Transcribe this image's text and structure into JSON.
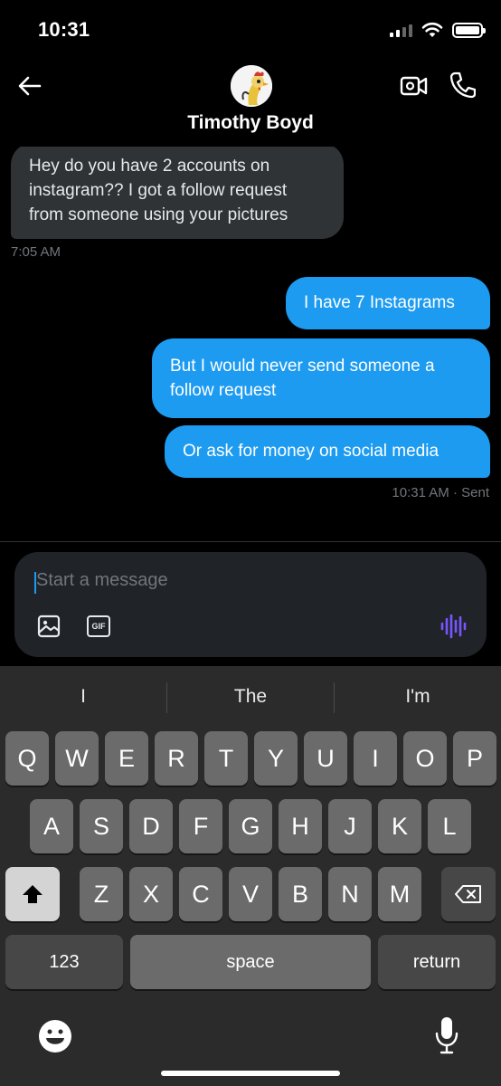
{
  "status_bar": {
    "time": "10:31"
  },
  "header": {
    "contact_name": "Timothy Boyd"
  },
  "messages": [
    {
      "direction": "in",
      "lines": [
        "Hey do you have 2 accounts on",
        "instagram?? I got a follow request",
        "from someone using your pictures"
      ]
    },
    {
      "direction": "out",
      "lines": [
        "I have 7 Instagrams"
      ]
    },
    {
      "direction": "out",
      "lines": [
        "But I would never send someone a",
        "follow request"
      ]
    },
    {
      "direction": "out",
      "lines": [
        "Or ask for money on social media"
      ]
    }
  ],
  "timestamps": {
    "received": "7:05 AM",
    "sent": "10:31 AM · Sent"
  },
  "composer": {
    "placeholder": "Start a message",
    "gif_label": "GIF"
  },
  "keyboard": {
    "suggestions": [
      "I",
      "The",
      "I'm"
    ],
    "row1": [
      "Q",
      "W",
      "E",
      "R",
      "T",
      "Y",
      "U",
      "I",
      "O",
      "P"
    ],
    "row2": [
      "A",
      "S",
      "D",
      "F",
      "G",
      "H",
      "J",
      "K",
      "L"
    ],
    "row3": [
      "Z",
      "X",
      "C",
      "V",
      "B",
      "N",
      "M"
    ],
    "numbers_label": "123",
    "space_label": "space",
    "return_label": "return"
  },
  "icons": {
    "back": "arrow-left-icon",
    "video": "video-camera-icon",
    "phone": "phone-icon",
    "react": "heart-plus-icon",
    "media": "image-icon",
    "gif": "gif-icon",
    "voice": "voice-waveform-icon",
    "shift": "shift-icon",
    "delete": "backspace-icon",
    "emoji": "emoji-icon",
    "mic": "microphone-icon"
  },
  "colors": {
    "accent": "#1d9bf0",
    "incoming_bubble": "#2f3336",
    "voice_icon": "#7856ff",
    "muted_text": "#71767b"
  }
}
